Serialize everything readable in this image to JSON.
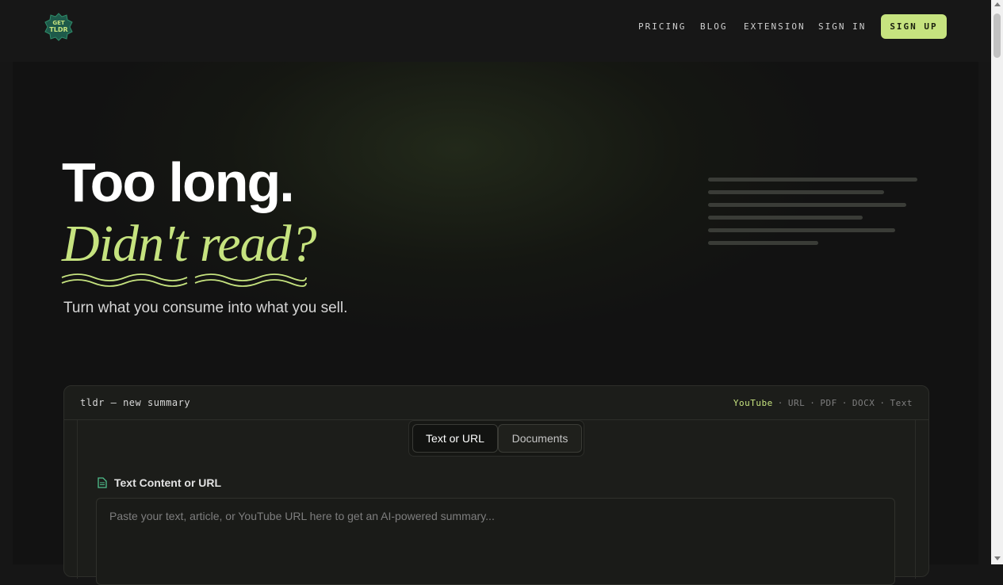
{
  "header": {
    "logo_alt": "GET TLDR",
    "nav": [
      "PRICING",
      "BLOG",
      "EXTENSION",
      "SIGN IN"
    ],
    "signup_label": "SIGN UP"
  },
  "hero": {
    "title_line1": "Too long.",
    "title_line2": "Didn't read?",
    "subtitle": "Turn what you consume into what you sell."
  },
  "card": {
    "title": "tldr — new summary",
    "formats": [
      "YouTube",
      "URL",
      "PDF",
      "DOCX",
      "Text"
    ],
    "tabs": [
      "Text or URL",
      "Documents"
    ],
    "field_label": "Text Content or URL",
    "input_placeholder": "Paste your text, article, or YouTube URL here to get an AI-powered summary..."
  },
  "colors": {
    "accent": "#c6e37f",
    "background": "#161616"
  }
}
